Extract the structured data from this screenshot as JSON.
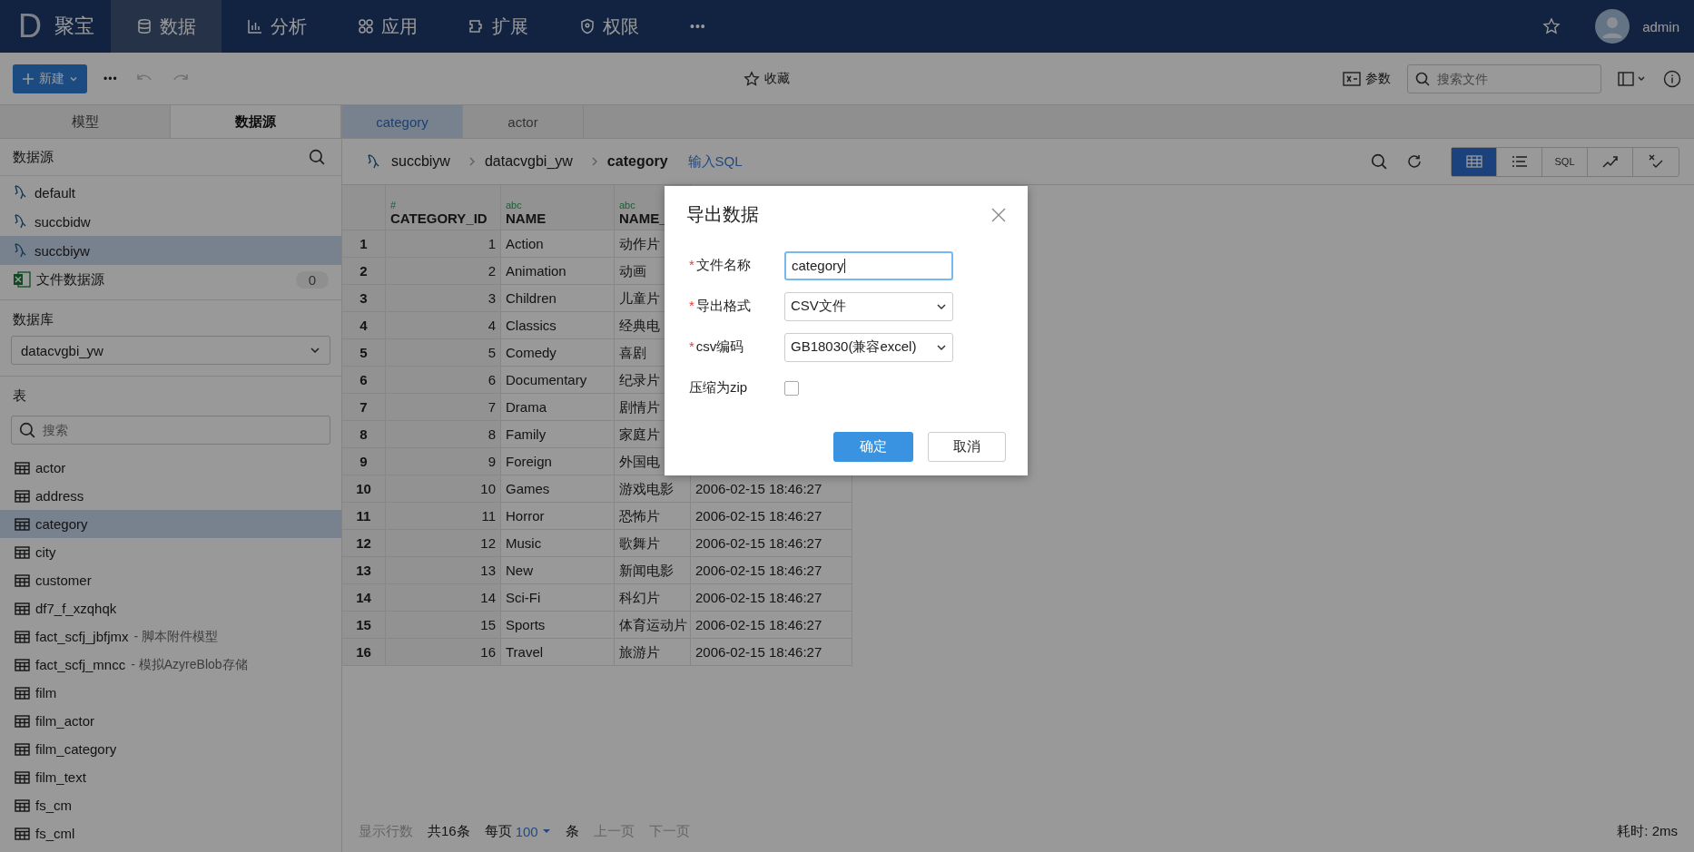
{
  "nav": {
    "logo": "D",
    "brand": "聚宝",
    "items": [
      {
        "label": "数据",
        "kind": "db",
        "selected": true
      },
      {
        "label": "分析",
        "kind": "chart",
        "selected": false
      },
      {
        "label": "应用",
        "kind": "apps",
        "selected": false
      },
      {
        "label": "扩展",
        "kind": "ext",
        "selected": false
      },
      {
        "label": "权限",
        "kind": "shield",
        "selected": false
      }
    ],
    "more": "•••",
    "user": "admin"
  },
  "toolbar": {
    "new_button": "新建",
    "more": "•••",
    "favorite": "收藏",
    "params": "参数",
    "search": {
      "placeholder": "搜索文件"
    }
  },
  "sidebar": {
    "tabs": [
      {
        "label": "模型",
        "selected": false
      },
      {
        "label": "数据源",
        "selected": true
      }
    ],
    "datasource_title": "数据源",
    "datasources": [
      {
        "name": "default",
        "kind": "db",
        "selected": false
      },
      {
        "name": "succbidw",
        "kind": "db",
        "selected": false
      },
      {
        "name": "succbiyw",
        "kind": "db",
        "selected": true
      },
      {
        "name": "文件数据源",
        "kind": "file",
        "count": "0",
        "selected": false
      }
    ],
    "database_label": "数据库",
    "database": "datacvgbi_yw",
    "tables_label": "表",
    "table_search": {
      "placeholder": "搜索"
    },
    "tables": [
      {
        "name": "actor",
        "selected": false
      },
      {
        "name": "address",
        "selected": false
      },
      {
        "name": "category",
        "selected": true
      },
      {
        "name": "city",
        "selected": false
      },
      {
        "name": "customer",
        "selected": false
      },
      {
        "name": "df7_f_xzqhqk",
        "selected": false
      },
      {
        "name": "fact_scfj_jbfjmx",
        "note": "- 脚本附件模型",
        "selected": false
      },
      {
        "name": "fact_scfj_mncc",
        "note": "- 模拟AzyreBlob存储",
        "selected": false
      },
      {
        "name": "film",
        "selected": false
      },
      {
        "name": "film_actor",
        "selected": false
      },
      {
        "name": "film_category",
        "selected": false
      },
      {
        "name": "film_text",
        "selected": false
      },
      {
        "name": "fs_cm",
        "selected": false
      },
      {
        "name": "fs_cml",
        "selected": false
      }
    ]
  },
  "tabs": [
    {
      "label": "category",
      "selected": true
    },
    {
      "label": "actor",
      "selected": false
    }
  ],
  "breadcrumb": [
    "succbiyw",
    "datacvgbi_yw",
    "category"
  ],
  "sql_link": "输入SQL",
  "view_buttons": [
    {
      "kind": "grid",
      "selected": true
    },
    {
      "kind": "list",
      "selected": false
    },
    {
      "kind": "sql",
      "label": "SQL",
      "selected": false
    },
    {
      "kind": "trend",
      "selected": false
    },
    {
      "kind": "check",
      "selected": false
    }
  ],
  "table": {
    "columns": [
      {
        "type": "#",
        "name": "CATEGORY_ID"
      },
      {
        "type": "abc",
        "name": "NAME"
      },
      {
        "type": "abc",
        "name": "NAME_"
      }
    ],
    "rows": [
      {
        "num": "1",
        "cells": [
          "1",
          "Action",
          "动作片"
        ]
      },
      {
        "num": "2",
        "cells": [
          "2",
          "Animation",
          "动画"
        ]
      },
      {
        "num": "3",
        "cells": [
          "3",
          "Children",
          "儿童片"
        ]
      },
      {
        "num": "4",
        "cells": [
          "4",
          "Classics",
          "经典电"
        ]
      },
      {
        "num": "5",
        "cells": [
          "5",
          "Comedy",
          "喜剧"
        ]
      },
      {
        "num": "6",
        "cells": [
          "6",
          "Documentary",
          "纪录片"
        ]
      },
      {
        "num": "7",
        "cells": [
          "7",
          "Drama",
          "剧情片"
        ]
      },
      {
        "num": "8",
        "cells": [
          "8",
          "Family",
          "家庭片"
        ]
      },
      {
        "num": "9",
        "cells": [
          "9",
          "Foreign",
          "外国电"
        ]
      },
      {
        "num": "10",
        "cells": [
          "10",
          "Games",
          "游戏电影",
          "2006-02-15 18:46:27"
        ]
      },
      {
        "num": "11",
        "cells": [
          "11",
          "Horror",
          "恐怖片",
          "2006-02-15 18:46:27"
        ]
      },
      {
        "num": "12",
        "cells": [
          "12",
          "Music",
          "歌舞片",
          "2006-02-15 18:46:27"
        ]
      },
      {
        "num": "13",
        "cells": [
          "13",
          "New",
          "新闻电影",
          "2006-02-15 18:46:27"
        ]
      },
      {
        "num": "14",
        "cells": [
          "14",
          "Sci-Fi",
          "科幻片",
          "2006-02-15 18:46:27"
        ]
      },
      {
        "num": "15",
        "cells": [
          "15",
          "Sports",
          "体育运动片",
          "2006-02-15 18:46:27"
        ]
      },
      {
        "num": "16",
        "cells": [
          "16",
          "Travel",
          "旅游片",
          "2006-02-15 18:46:27"
        ]
      }
    ]
  },
  "footer": {
    "rows_label": "显示行数",
    "total": "共16条",
    "per_page": "每页",
    "page_size": "100",
    "unit": "条",
    "prev": "上一页",
    "next": "下一页",
    "prev_disabled": true,
    "next_disabled": true,
    "elapsed": "耗时: 2ms"
  },
  "dialog": {
    "title": "导出数据",
    "required_mark": "*",
    "fields": [
      {
        "kind": "input",
        "label": "文件名称",
        "required": true,
        "value": "category"
      },
      {
        "kind": "select",
        "label": "导出格式",
        "required": true,
        "value": "CSV文件"
      },
      {
        "kind": "select",
        "label": "csv编码",
        "required": true,
        "value": "GB18030(兼容excel)"
      },
      {
        "kind": "checkbox",
        "label": "压缩为zip",
        "required": false,
        "checked": false
      }
    ],
    "ok": "确定",
    "cancel": "取消"
  }
}
